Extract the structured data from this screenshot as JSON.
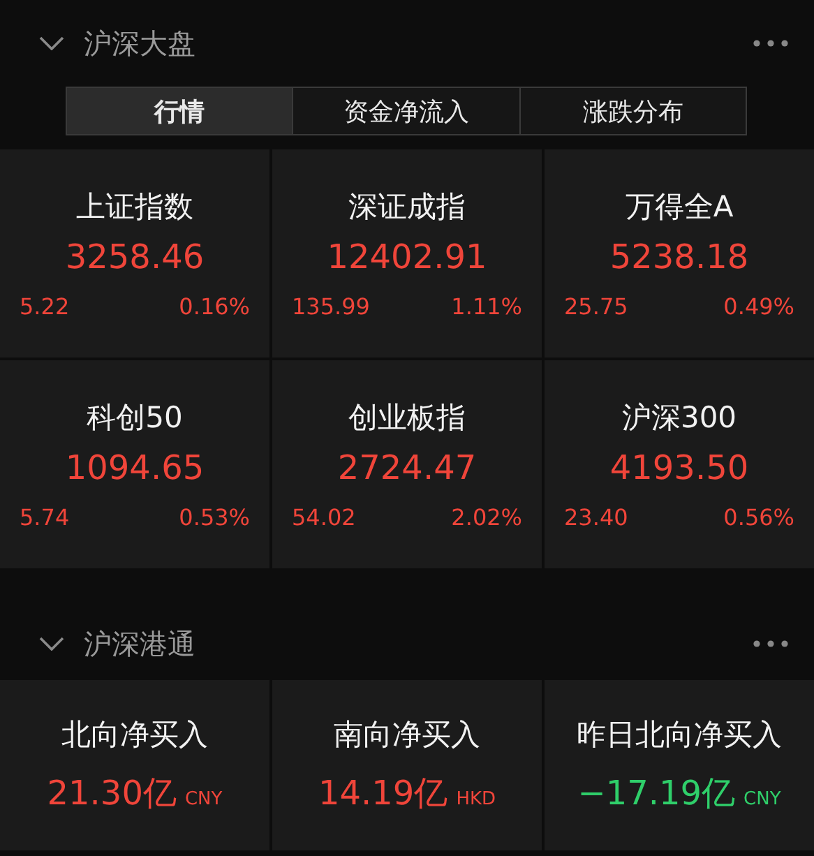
{
  "market": {
    "title": "沪深大盘",
    "tabs": [
      {
        "label": "行情",
        "selected": true
      },
      {
        "label": "资金净流入",
        "selected": false
      },
      {
        "label": "涨跌分布",
        "selected": false
      }
    ],
    "indices": [
      {
        "name": "上证指数",
        "value": "3258.46",
        "change": "5.22",
        "pct": "0.16%",
        "kind": "up"
      },
      {
        "name": "深证成指",
        "value": "12402.91",
        "change": "135.99",
        "pct": "1.11%",
        "kind": "up"
      },
      {
        "name": "万得全A",
        "value": "5238.18",
        "change": "25.75",
        "pct": "0.49%",
        "kind": "up"
      },
      {
        "name": "科创50",
        "value": "1094.65",
        "change": "5.74",
        "pct": "0.53%",
        "kind": "up"
      },
      {
        "name": "创业板指",
        "value": "2724.47",
        "change": "54.02",
        "pct": "2.02%",
        "kind": "up"
      },
      {
        "name": "沪深300",
        "value": "4193.50",
        "change": "23.40",
        "pct": "0.56%",
        "kind": "up"
      }
    ]
  },
  "connect": {
    "title": "沪深港通",
    "flows": [
      {
        "label": "北向净买入",
        "value": "21.30亿",
        "currency": "CNY",
        "kind": "up"
      },
      {
        "label": "南向净买入",
        "value": "14.19亿",
        "currency": "HKD",
        "kind": "up"
      },
      {
        "label": "昨日北向净买入",
        "value": "−17.19亿",
        "currency": "CNY",
        "kind": "down"
      }
    ]
  }
}
